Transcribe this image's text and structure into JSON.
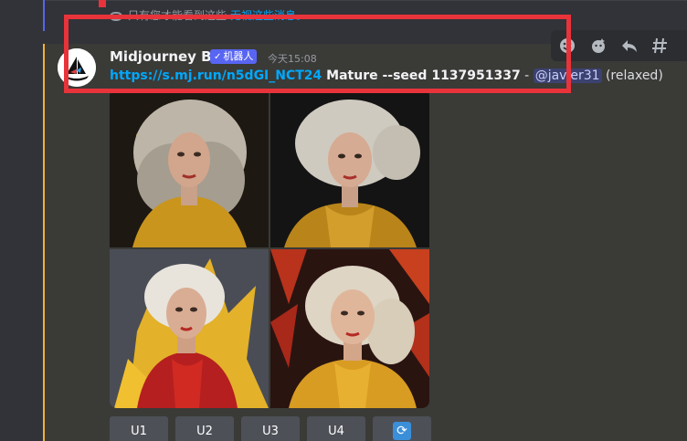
{
  "notice": {
    "text": "只有您才能看到这些",
    "link": "无视这些消息。"
  },
  "message": {
    "username": "Midjourney Bot",
    "bot_tag": "机器人",
    "timestamp": "今天15:08",
    "link": "https://s.mj.run/n5dGI_NCT24",
    "prompt": " Mature --seed 1137951337",
    "separator": " - ",
    "mention": "@javier31",
    "mode": " (relaxed)"
  },
  "buttons": {
    "u1": "U1",
    "u2": "U2",
    "u3": "U3",
    "u4": "U4",
    "refresh_icon": "refresh-icon"
  },
  "toolbar_icons": [
    "add-reaction-icon",
    "super-reaction-icon",
    "reply-icon",
    "thread-icon"
  ],
  "colors": {
    "accent": "#5865f2",
    "link": "#00a8fc",
    "highlight_bar": "#f0b232",
    "annotation": "#e8333a"
  }
}
